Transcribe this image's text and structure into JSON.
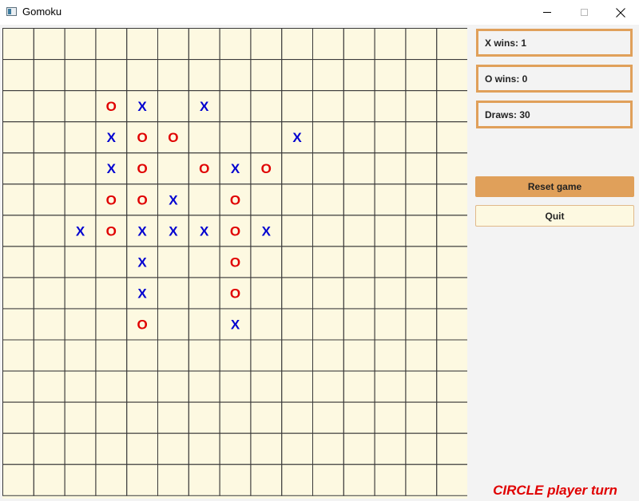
{
  "window": {
    "title": "Gomoku",
    "icon": "app-window-icon"
  },
  "board": {
    "rows": 15,
    "cols": 15,
    "colors": {
      "background": "#fdf9e1",
      "grid": "#3a3a3a",
      "x": "#0000d0",
      "o": "#e00000"
    },
    "moves": [
      {
        "row": 2,
        "col": 3,
        "mark": "O"
      },
      {
        "row": 2,
        "col": 4,
        "mark": "X"
      },
      {
        "row": 2,
        "col": 6,
        "mark": "X"
      },
      {
        "row": 3,
        "col": 3,
        "mark": "X"
      },
      {
        "row": 3,
        "col": 4,
        "mark": "O"
      },
      {
        "row": 3,
        "col": 5,
        "mark": "O"
      },
      {
        "row": 3,
        "col": 9,
        "mark": "X"
      },
      {
        "row": 4,
        "col": 3,
        "mark": "X"
      },
      {
        "row": 4,
        "col": 4,
        "mark": "O"
      },
      {
        "row": 4,
        "col": 6,
        "mark": "O"
      },
      {
        "row": 4,
        "col": 7,
        "mark": "X"
      },
      {
        "row": 4,
        "col": 8,
        "mark": "O"
      },
      {
        "row": 5,
        "col": 3,
        "mark": "O"
      },
      {
        "row": 5,
        "col": 4,
        "mark": "O"
      },
      {
        "row": 5,
        "col": 5,
        "mark": "X"
      },
      {
        "row": 5,
        "col": 7,
        "mark": "O"
      },
      {
        "row": 6,
        "col": 2,
        "mark": "X"
      },
      {
        "row": 6,
        "col": 3,
        "mark": "O"
      },
      {
        "row": 6,
        "col": 4,
        "mark": "X"
      },
      {
        "row": 6,
        "col": 5,
        "mark": "X"
      },
      {
        "row": 6,
        "col": 6,
        "mark": "X"
      },
      {
        "row": 6,
        "col": 7,
        "mark": "O"
      },
      {
        "row": 6,
        "col": 8,
        "mark": "X"
      },
      {
        "row": 7,
        "col": 4,
        "mark": "X"
      },
      {
        "row": 7,
        "col": 7,
        "mark": "O"
      },
      {
        "row": 8,
        "col": 4,
        "mark": "X"
      },
      {
        "row": 8,
        "col": 7,
        "mark": "O"
      },
      {
        "row": 9,
        "col": 4,
        "mark": "O"
      },
      {
        "row": 9,
        "col": 7,
        "mark": "X"
      }
    ]
  },
  "scores": {
    "x_wins": "X wins: 1",
    "o_wins": "O wins: 0",
    "draws": "Draws: 30"
  },
  "buttons": {
    "reset": "Reset game",
    "quit": "Quit"
  },
  "status": {
    "turn": "CIRCLE player turn"
  },
  "accent": "#e0a05a"
}
